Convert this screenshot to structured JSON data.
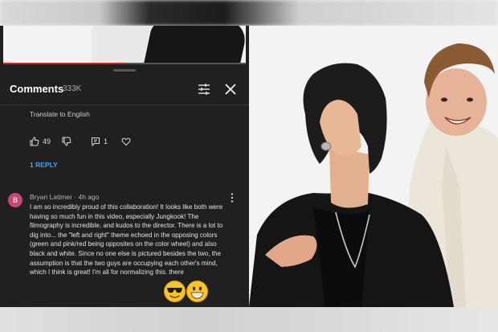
{
  "comments": {
    "title": "Comments",
    "count": "333K",
    "translate_link": "Translate to English",
    "like_count": "49",
    "reply_count": "1",
    "replies_link": "1 REPLY",
    "video_progress_percent": 50
  },
  "comment": {
    "avatar_initial": "B",
    "author": "Bryan Latimer",
    "time": "4h ago",
    "text": "I am so incredibly proud of this collaboration!  It looks like both were having so much fun in this video, especially Jungkook!  The filmography is incredible, and kudos to the director.  There is a lot to dig into... the \"left and right\" theme echoed in the opposing colors (green and pink/red being opposites on the color wheel) and also black and white.  Since no one else is pictured besides the two, the assumption is that the two guys are occupying each other's mind, which I think is great!  I'm all for normalizing this.           there"
  },
  "colors": {
    "panel_bg": "#202020",
    "link_blue": "#3ea6ff",
    "progress_red": "#e02020",
    "avatar_pink": "#c2487a"
  },
  "icons": [
    "drag-handle",
    "filter-icon",
    "close-icon",
    "thumb-up-icon",
    "thumb-down-icon",
    "reply-icon",
    "heart-icon",
    "more-vert-icon",
    "sunglasses-emoji",
    "grin-emoji"
  ]
}
